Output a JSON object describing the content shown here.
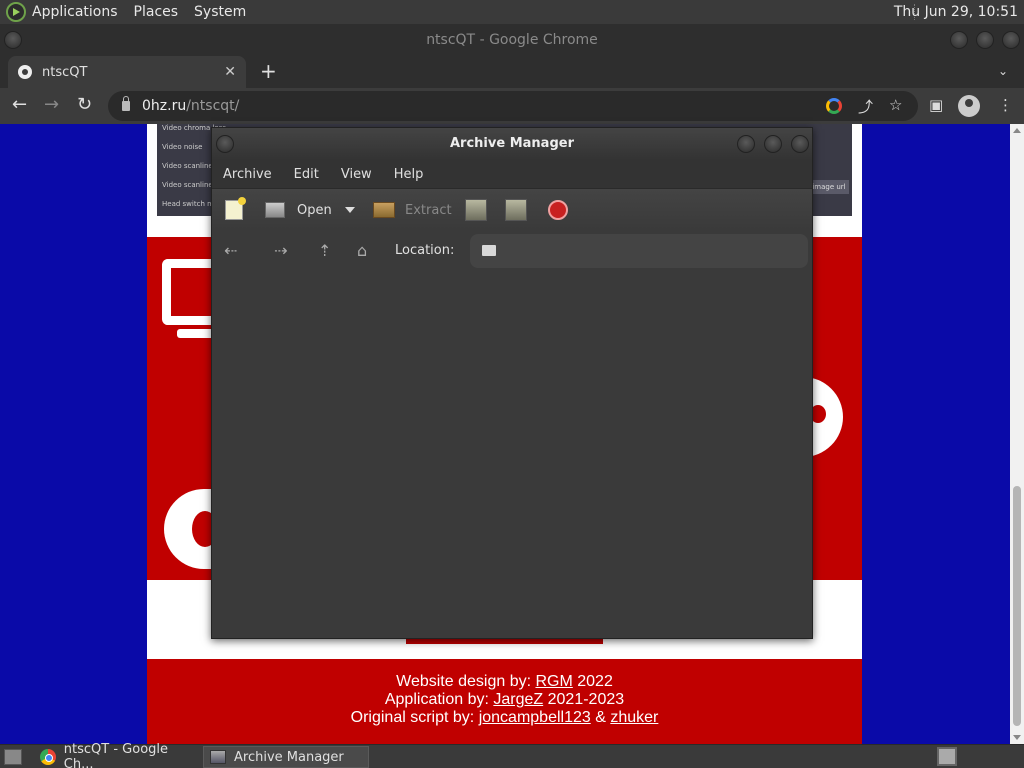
{
  "top_panel": {
    "menus": [
      "Applications",
      "Places",
      "System"
    ],
    "clock": "Thu Jun 29, 10:51"
  },
  "chrome": {
    "window_title": "ntscQT - Google Chrome",
    "tab_title": "ntscQT",
    "url_host": "0hz.ru",
    "url_path": "/ntscqt/"
  },
  "website": {
    "screenshot_rows": [
      "Video chroma loss",
      "Video noise",
      "Video scanline p",
      "Video scanline p",
      "Head switch mo"
    ],
    "screenshot_button": "image url",
    "footer": {
      "line1_prefix": "Website design by: ",
      "line1_link": "RGM",
      "line1_suffix": " 2022",
      "line2_prefix": "Application by: ",
      "line2_link": "JargeZ",
      "line2_suffix": " 2021-2023",
      "line3_prefix": "Original script by: ",
      "line3_link1": "joncampbell123",
      "line3_mid": " & ",
      "line3_link2": "zhuker"
    }
  },
  "archive_manager": {
    "title": "Archive Manager",
    "menus": [
      "Archive",
      "Edit",
      "View",
      "Help"
    ],
    "toolbar": {
      "open_label": "Open",
      "extract_label": "Extract"
    },
    "location_label": "Location:"
  },
  "taskbar": {
    "tasks": [
      "ntscQT - Google Ch...",
      "Archive Manager"
    ]
  }
}
